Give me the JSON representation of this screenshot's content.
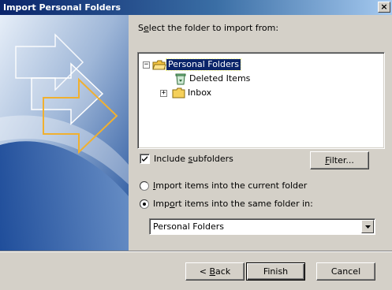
{
  "window": {
    "title": "Import Personal Folders",
    "close_label": "×"
  },
  "prompt": {
    "pre": "S",
    "ul": "e",
    "post": "lect the folder to import from:"
  },
  "tree": {
    "items": [
      {
        "label": "Personal Folders",
        "expander": "−",
        "selected": true
      },
      {
        "label": "Deleted Items"
      },
      {
        "label": "Inbox",
        "expander": "+"
      }
    ]
  },
  "include_subfolders": {
    "pre": "Include ",
    "ul": "s",
    "post": "ubfolders",
    "checked": true
  },
  "filter_button": {
    "ul": "F",
    "post": "ilter..."
  },
  "radios": [
    {
      "ul": "I",
      "post": "mport items into the current folder",
      "checked": false
    },
    {
      "pre": "Imp",
      "ul": "o",
      "post": "rt items into the same folder in:",
      "checked": true
    }
  ],
  "folder_select": {
    "value": "Personal Folders"
  },
  "buttons": {
    "back": {
      "pre": "< ",
      "ul": "B",
      "post": "ack"
    },
    "finish": "Finish",
    "cancel": "Cancel"
  },
  "colors": {
    "title_start": "#0a246a",
    "title_end": "#a6caf0",
    "face": "#d4d0c8",
    "selection": "#0a246a"
  }
}
